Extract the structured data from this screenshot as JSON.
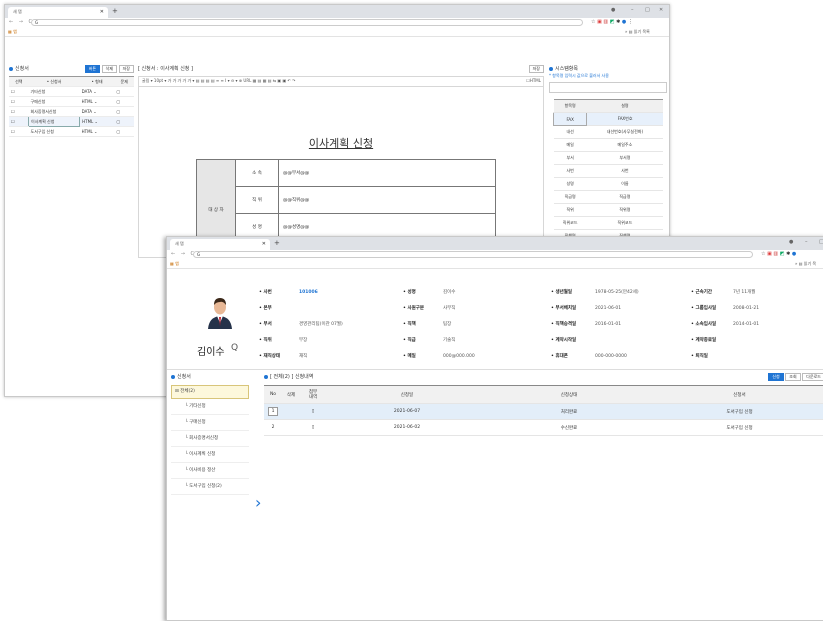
{
  "back": {
    "tab_title": "새 탭",
    "address": "G",
    "bookmark_label": "앱",
    "reading_list": "읽기 목록",
    "left_panel": {
      "title": "신청서",
      "btn_new": "버튼",
      "btn_delete": "삭제",
      "btn_save": "저장",
      "headers": [
        "선택",
        "• 신청서",
        "• 형태",
        "문제"
      ],
      "rows": [
        {
          "name": "기타신청",
          "type": "DATA"
        },
        {
          "name": "구매신청",
          "type": "HTML"
        },
        {
          "name": "회사증명서신청",
          "type": "DATA"
        },
        {
          "name": "이사계획 신청",
          "type": "HTML"
        },
        {
          "name": "도서구입 신청",
          "type": "HTML"
        }
      ]
    },
    "editor": {
      "header": "[ 신청서 : 이사계획 신청 ]",
      "save": "저장",
      "toolbar": "굴림 ▾ 10pt ▾  가 가 가 가 가 ▾ ▤ ▤ ▤ ▤  ≡ ≡ I ▾ ⊖ ▾  ⊕ URL ▦ ▤ ▦ ▤ ⇆ ▣ ▣ ↶ ↷",
      "html_toggle": "HTML",
      "doc_title": "이사계획 신청",
      "label_applicant": "대 상 자",
      "form_rows": [
        {
          "label": "소    속",
          "value": "@@부서@@"
        },
        {
          "label": "직    위",
          "value": "@@직위@@"
        },
        {
          "label": "성    명",
          "value": "@@성명@@"
        }
      ]
    },
    "sys": {
      "title": "시스템항목",
      "desc": "* 항목명 입력시 값으로 불러서 사용",
      "headers": [
        "항목명",
        "설명"
      ],
      "rows": [
        [
          "FAX",
          "FAX번호"
        ],
        [
          "내선",
          "내선번호(사무실전화)"
        ],
        [
          "메일",
          "메일주소"
        ],
        [
          "부서",
          "부서명"
        ],
        [
          "사번",
          "사번"
        ],
        [
          "성명",
          "이름"
        ],
        [
          "직급명",
          "직급명"
        ],
        [
          "직위",
          "직위명"
        ],
        [
          "직위코드",
          "직위코드"
        ],
        [
          "직책명",
          "직책명"
        ]
      ]
    }
  },
  "front": {
    "tab_title": "새 탭",
    "address": "G",
    "bookmark_label": "앱",
    "reading_list": "읽기 목",
    "profile": {
      "name": "김이수",
      "search_icon": "Q",
      "col1": [
        {
          "k": "• 사번",
          "v": "101006"
        },
        {
          "k": "• 본부",
          "v": ""
        },
        {
          "k": "• 부서",
          "v": "경영관리팀(이관 07월)"
        },
        {
          "k": "• 직위",
          "v": "부장"
        },
        {
          "k": "• 재직상태",
          "v": "재직"
        }
      ],
      "col2": [
        {
          "k": "• 성명",
          "v": "김이수"
        },
        {
          "k": "• 사원구분",
          "v": "사무직"
        },
        {
          "k": "• 직책",
          "v": "팀장"
        },
        {
          "k": "• 직급",
          "v": "기술직"
        },
        {
          "k": "• 메일",
          "v": "000@000.000"
        }
      ],
      "col3": [
        {
          "k": "• 생년월일",
          "v": "1978-05-25(만42세)"
        },
        {
          "k": "• 부서배치일",
          "v": "2021-06-01"
        },
        {
          "k": "• 직책승격일",
          "v": "2016-01-01"
        },
        {
          "k": "• 계약시작일",
          "v": ""
        },
        {
          "k": "• 휴대폰",
          "v": "000-000-0000"
        }
      ],
      "col4": [
        {
          "k": "• 근속기간",
          "v": "7년 11개월"
        },
        {
          "k": "• 그룹입사일",
          "v": "2008-01-21"
        },
        {
          "k": "• 소속입사일",
          "v": "2014-01-01"
        },
        {
          "k": "• 계약종료일",
          "v": ""
        },
        {
          "k": "• 퇴직일",
          "v": ""
        }
      ]
    },
    "forms": {
      "title": "신청서",
      "root": "전체(2)",
      "items": [
        "기타신청",
        "구매신청",
        "회사증명서신청",
        "이사계획 신청",
        "이사비용 정산",
        "도서구입 신청(2)"
      ]
    },
    "list": {
      "title": "[ 전체(2) ] 신청내역",
      "btn_apply": "신청",
      "btn_search": "조회",
      "btn_download": "다운로드",
      "headers": [
        "No",
        "삭제",
        "첨부\n내역",
        "신청일",
        "신청상태",
        "신청서"
      ],
      "rows": [
        {
          "no": "1",
          "date": "2021-06-07",
          "status": "처리완료",
          "form": "도서구입 신청"
        },
        {
          "no": "2",
          "date": "2021-06-02",
          "status": "수신완료",
          "form": "도서구입 신청"
        }
      ]
    }
  }
}
